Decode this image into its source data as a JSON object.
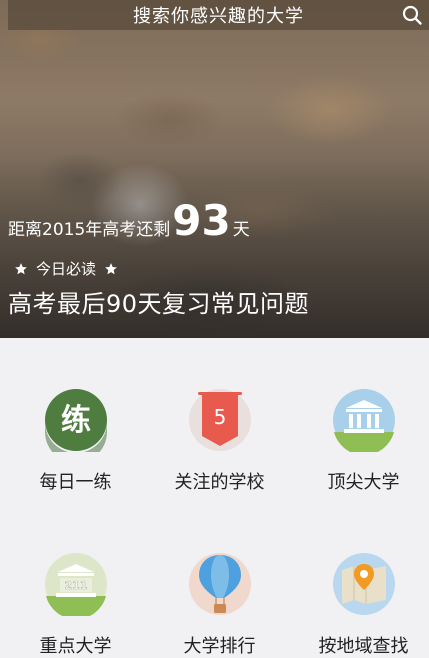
{
  "search": {
    "text": "搜索你感兴趣的大学"
  },
  "banner": {
    "countdown_prefix": "距离2015年高考还剩",
    "countdown_days": "93",
    "countdown_unit": "天",
    "must_read": "今日必读",
    "headline": "高考最后90天复习常见问题"
  },
  "menu": {
    "items": [
      {
        "label": "每日一练",
        "icon": "practice-icon",
        "icon_text": "练"
      },
      {
        "label": "关注的学校",
        "icon": "bookmark-icon",
        "icon_text": "5"
      },
      {
        "label": "顶尖大学",
        "icon": "university-icon"
      },
      {
        "label": "重点大学",
        "icon": "university-211-icon",
        "icon_text": "211"
      },
      {
        "label": "大学排行",
        "icon": "balloon-icon"
      },
      {
        "label": "按地域查找",
        "icon": "map-pin-icon"
      }
    ]
  },
  "colors": {
    "practice_green": "#4e7d3f",
    "bookmark_red": "#e8594e",
    "accent_blue": "#8fc3e4",
    "balloon_blue": "#4fa0de",
    "map_orange": "#f29a22"
  }
}
